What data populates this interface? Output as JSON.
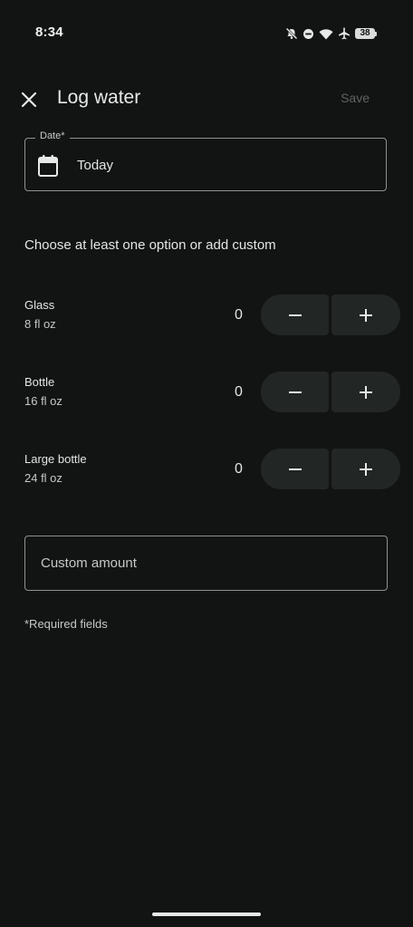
{
  "status_bar": {
    "time": "8:34",
    "battery": "38",
    "icons": [
      "mute-icon",
      "dnd-icon",
      "wifi-icon",
      "airplane-icon",
      "battery-icon"
    ]
  },
  "app_bar": {
    "title": "Log water",
    "save_label": "Save",
    "close_icon": "close-icon"
  },
  "date_field": {
    "label": "Date*",
    "value": "Today",
    "icon": "calendar-icon"
  },
  "instruction": "Choose at least one option or add custom",
  "options": [
    {
      "name": "Glass",
      "size": "8 fl oz",
      "count": "0"
    },
    {
      "name": "Bottle",
      "size": "16 fl oz",
      "count": "0"
    },
    {
      "name": "Large bottle",
      "size": "24 fl oz",
      "count": "0"
    }
  ],
  "custom_amount": {
    "placeholder": "Custom amount"
  },
  "required_note": "*Required fields",
  "colors": {
    "background": "#111413",
    "stepper": "#222624",
    "outline": "#8d928f",
    "save_disabled": "#5f6462"
  }
}
